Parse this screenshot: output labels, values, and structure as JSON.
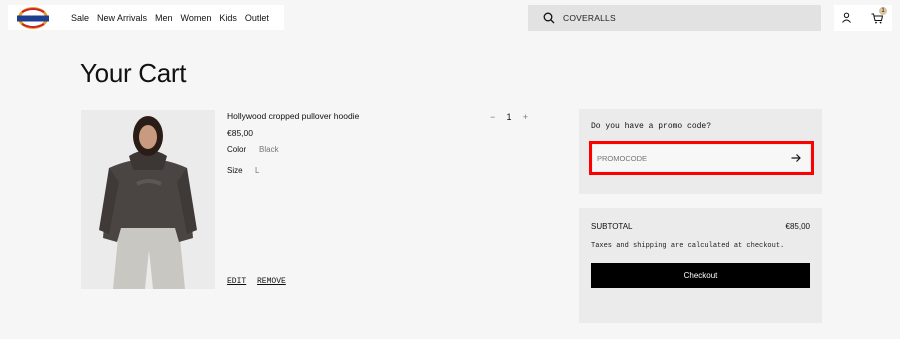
{
  "nav": {
    "links": [
      "Sale",
      "New Arrivals",
      "Men",
      "Women",
      "Kids",
      "Outlet"
    ]
  },
  "search": {
    "value": "COVERALLS",
    "icon": "search-icon"
  },
  "cart": {
    "count": "1"
  },
  "page": {
    "title": "Your Cart"
  },
  "item": {
    "name": "Hollywood cropped pullover hoodie",
    "price": "€85,00",
    "color_label": "Color",
    "color_value": "Black",
    "size_label": "Size",
    "size_value": "L",
    "quantity": "1",
    "qty_minus": "−",
    "qty_plus": "+",
    "edit_label": "EDIT",
    "remove_label": "REMOVE"
  },
  "promo": {
    "question": "Do you have a promo code?",
    "placeholder": "PROMOCODE"
  },
  "summary": {
    "subtotal_label": "SUBTOTAL",
    "subtotal_value": "€85,00",
    "note": "Taxes and shipping are calculated at checkout.",
    "checkout_label": "Checkout"
  },
  "colors": {
    "accent_highlight": "#ff0000",
    "button": "#000000"
  }
}
